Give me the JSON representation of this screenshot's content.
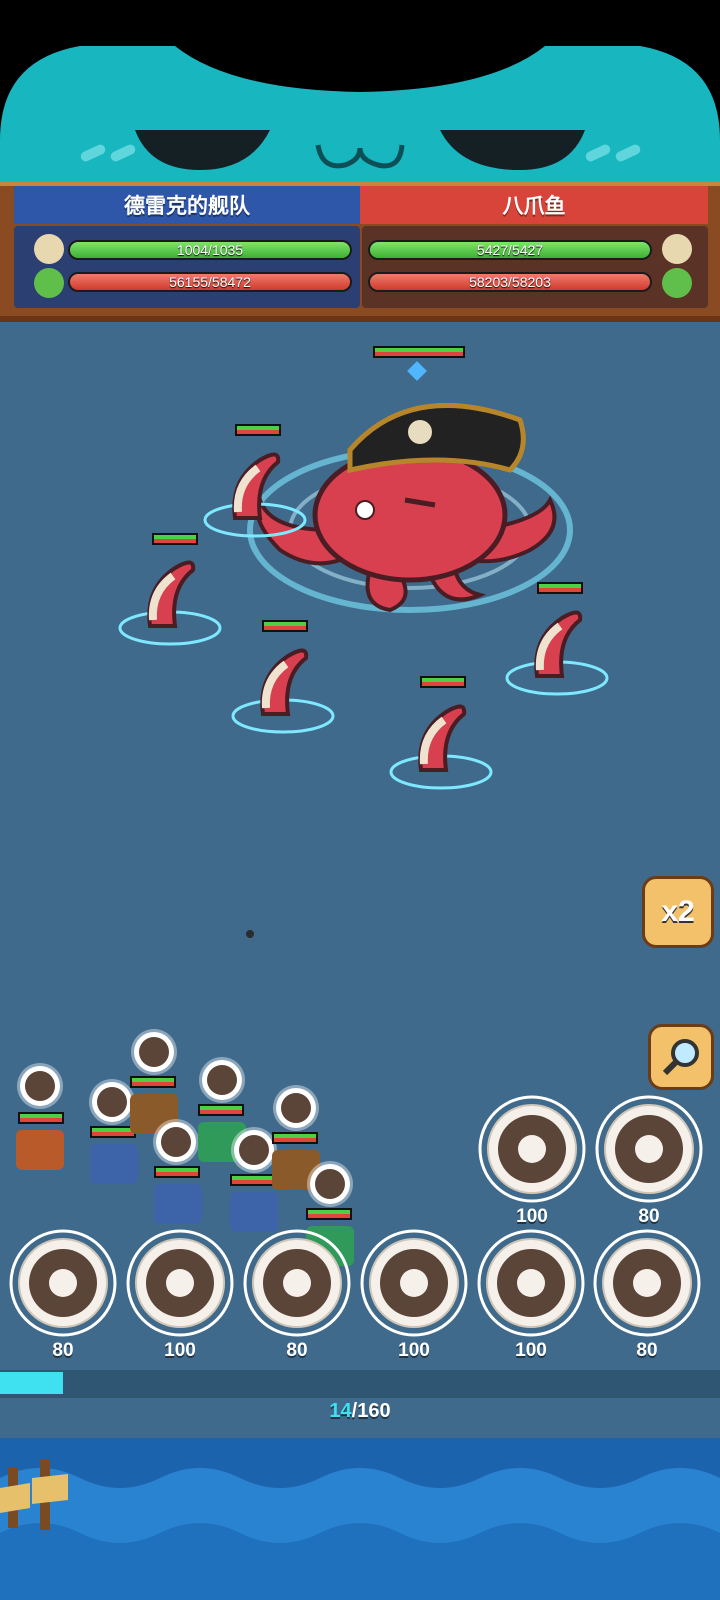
{
  "teams": {
    "left": {
      "name": "德雷克的舰队",
      "crew_hp": "1004/1035",
      "ship_hp": "56155/58472",
      "crew_ratio": 0.97,
      "ship_ratio": 0.96
    },
    "right": {
      "name": "八爪鱼",
      "crew_hp": "5427/5427",
      "ship_hp": "58203/58203",
      "crew_ratio": 1.0,
      "ship_ratio": 1.0
    }
  },
  "controls": {
    "speed_label": "x2"
  },
  "skills": [
    {
      "cost": "100",
      "icon": "lightning-orb-icon"
    },
    {
      "cost": "80",
      "icon": "cannonball-icon"
    },
    {
      "cost": "80",
      "icon": "shuriken-icon"
    },
    {
      "cost": "100",
      "icon": "whale-icon"
    },
    {
      "cost": "80",
      "icon": "shark-icon"
    },
    {
      "cost": "100",
      "icon": "ring-icon"
    },
    {
      "cost": "100",
      "icon": "winged-skull-icon"
    },
    {
      "cost": "80",
      "icon": "burst-icon"
    }
  ],
  "energy": {
    "current": "14",
    "max": "/160",
    "fraction": 0.0875
  },
  "colors": {
    "sea": "#3f6a8c",
    "accent_cyan": "#3fe0f0",
    "team_blue": "#2f57a9",
    "team_red": "#d8443a",
    "wood": "#8a4a22"
  }
}
